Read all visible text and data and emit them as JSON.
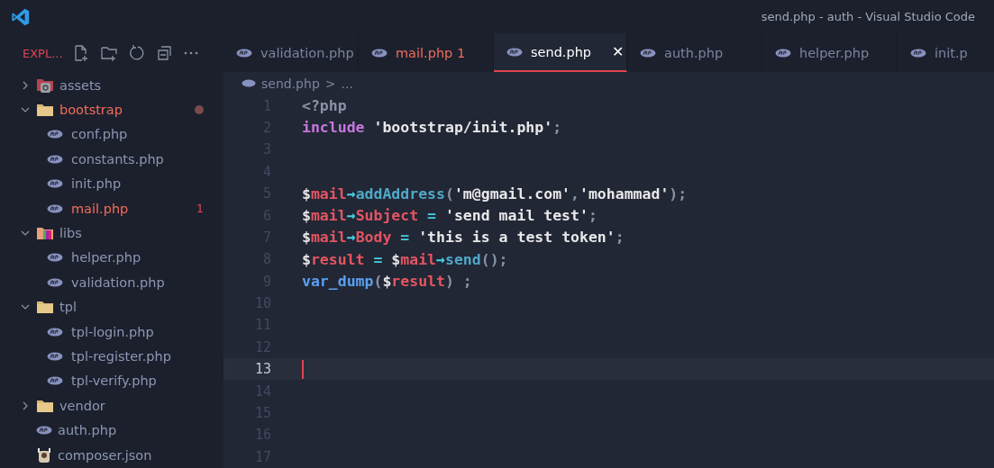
{
  "window": {
    "title": "send.php - auth - Visual Studio Code"
  },
  "explorer": {
    "title": "EXPL...",
    "items": [
      {
        "kind": "assets",
        "label": "assets",
        "expanded": false,
        "error": false
      },
      {
        "kind": "folder",
        "label": "bootstrap",
        "expanded": true,
        "error": true,
        "dot": true,
        "children": [
          {
            "kind": "php",
            "label": "conf.php",
            "error": false
          },
          {
            "kind": "php",
            "label": "constants.php",
            "error": false
          },
          {
            "kind": "php",
            "label": "init.php",
            "error": false
          },
          {
            "kind": "php",
            "label": "mail.php",
            "error": true,
            "badge": "1"
          }
        ]
      },
      {
        "kind": "libs",
        "label": "libs",
        "expanded": true,
        "error": false,
        "children": [
          {
            "kind": "php",
            "label": "helper.php",
            "error": false
          },
          {
            "kind": "php",
            "label": "validation.php",
            "error": false
          }
        ]
      },
      {
        "kind": "folder",
        "label": "tpl",
        "expanded": true,
        "error": false,
        "children": [
          {
            "kind": "php",
            "label": "tpl-login.php",
            "error": false
          },
          {
            "kind": "php",
            "label": "tpl-register.php",
            "error": false
          },
          {
            "kind": "php",
            "label": "tpl-verify.php",
            "error": false
          }
        ]
      },
      {
        "kind": "folder",
        "label": "vendor",
        "expanded": false,
        "error": false
      },
      {
        "kind": "php",
        "label": "auth.php",
        "error": false
      },
      {
        "kind": "json",
        "label": "composer.json",
        "error": false
      }
    ]
  },
  "tabs": [
    {
      "label": "validation.php",
      "selected": false,
      "error": false
    },
    {
      "label": "mail.php",
      "selected": false,
      "error": true,
      "badge": "1"
    },
    {
      "label": "send.php",
      "selected": true,
      "error": false,
      "close": "✕"
    },
    {
      "label": "auth.php",
      "selected": false,
      "error": false
    },
    {
      "label": "helper.php",
      "selected": false,
      "error": false
    },
    {
      "label": "init.p",
      "selected": false,
      "error": false
    }
  ],
  "breadcrumb": {
    "file": "send.php",
    "separator": ">",
    "rest": "..."
  },
  "editor": {
    "lines": [
      {
        "number": "1",
        "current": false,
        "tokens": [
          {
            "kind": "punct",
            "text": "<?php"
          }
        ]
      },
      {
        "number": "2",
        "current": false,
        "tokens": [
          {
            "kind": "keyword",
            "text": "include"
          },
          {
            "kind": "string",
            "text": " 'bootstrap/init.php'"
          },
          {
            "kind": "punct",
            "text": ";"
          }
        ]
      },
      {
        "number": "3",
        "current": false
      },
      {
        "number": "4",
        "current": false
      },
      {
        "number": "5",
        "current": false,
        "tokens": [
          {
            "kind": "sigil",
            "text": "$"
          },
          {
            "kind": "var",
            "text": "mail"
          },
          {
            "kind": "arrow",
            "text": "→"
          },
          {
            "kind": "method",
            "text": "addAddress"
          },
          {
            "kind": "punct",
            "text": "("
          },
          {
            "kind": "string",
            "text": "'m@gmail.com'"
          },
          {
            "kind": "punct",
            "text": ","
          },
          {
            "kind": "string",
            "text": "'mohammad'"
          },
          {
            "kind": "punct",
            "text": ");"
          }
        ]
      },
      {
        "number": "6",
        "current": false,
        "tokens": [
          {
            "kind": "sigil",
            "text": "$"
          },
          {
            "kind": "var",
            "text": "mail"
          },
          {
            "kind": "arrow",
            "text": "→"
          },
          {
            "kind": "var",
            "text": "Subject"
          },
          {
            "kind": "arrow",
            "text": " = "
          },
          {
            "kind": "string",
            "text": "'send mail test'"
          },
          {
            "kind": "punct",
            "text": ";"
          }
        ]
      },
      {
        "number": "7",
        "current": false,
        "tokens": [
          {
            "kind": "sigil",
            "text": "$"
          },
          {
            "kind": "var",
            "text": "mail"
          },
          {
            "kind": "arrow",
            "text": "→"
          },
          {
            "kind": "var",
            "text": "Body"
          },
          {
            "kind": "arrow",
            "text": " = "
          },
          {
            "kind": "string",
            "text": "'this is a test token'"
          },
          {
            "kind": "punct",
            "text": ";"
          }
        ]
      },
      {
        "number": "8",
        "current": false,
        "tokens": [
          {
            "kind": "sigil",
            "text": "$"
          },
          {
            "kind": "var",
            "text": "result"
          },
          {
            "kind": "arrow",
            "text": " = "
          },
          {
            "kind": "sigil",
            "text": "$"
          },
          {
            "kind": "var",
            "text": "mail"
          },
          {
            "kind": "arrow",
            "text": "→"
          },
          {
            "kind": "method",
            "text": "send"
          },
          {
            "kind": "punct",
            "text": "();"
          }
        ]
      },
      {
        "number": "9",
        "current": false,
        "tokens": [
          {
            "kind": "func",
            "text": "var_dump"
          },
          {
            "kind": "punct",
            "text": "("
          },
          {
            "kind": "sigil",
            "text": "$"
          },
          {
            "kind": "var",
            "text": "result"
          },
          {
            "kind": "punct",
            "text": ") ;"
          }
        ]
      },
      {
        "number": "10",
        "current": false
      },
      {
        "number": "11",
        "current": false
      },
      {
        "number": "12",
        "current": false
      },
      {
        "number": "13",
        "current": true
      },
      {
        "number": "14",
        "current": false
      },
      {
        "number": "15",
        "current": false
      },
      {
        "number": "16",
        "current": false
      },
      {
        "number": "17",
        "current": false
      }
    ]
  }
}
